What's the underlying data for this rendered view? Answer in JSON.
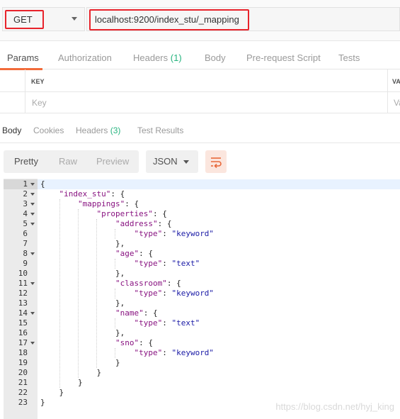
{
  "request": {
    "method": "GET",
    "url": "localhost:9200/index_stu/_mapping"
  },
  "request_tabs": [
    {
      "label": "Params",
      "count": ""
    },
    {
      "label": "Authorization",
      "count": ""
    },
    {
      "label": "Headers",
      "count": "(1)"
    },
    {
      "label": "Body",
      "count": ""
    },
    {
      "label": "Pre-request Script",
      "count": ""
    },
    {
      "label": "Tests",
      "count": ""
    }
  ],
  "params_table": {
    "key_header": "KEY",
    "value_header": "VA",
    "key_placeholder": "Key",
    "value_placeholder": "Va"
  },
  "response_tabs": [
    {
      "label": "Body",
      "count": ""
    },
    {
      "label": "Cookies",
      "count": ""
    },
    {
      "label": "Headers",
      "count": "(3)"
    },
    {
      "label": "Test Results",
      "count": ""
    }
  ],
  "view_modes": [
    "Pretty",
    "Raw",
    "Preview"
  ],
  "format": "JSON",
  "code_lines": [
    {
      "n": "1",
      "fold": true,
      "text": "{"
    },
    {
      "n": "2",
      "fold": true,
      "text": "    \"index_stu\": {"
    },
    {
      "n": "3",
      "fold": true,
      "text": "        \"mappings\": {"
    },
    {
      "n": "4",
      "fold": true,
      "text": "            \"properties\": {"
    },
    {
      "n": "5",
      "fold": true,
      "text": "                \"address\": {"
    },
    {
      "n": "6",
      "fold": false,
      "text": "                    \"type\": \"keyword\""
    },
    {
      "n": "7",
      "fold": false,
      "text": "                },"
    },
    {
      "n": "8",
      "fold": true,
      "text": "                \"age\": {"
    },
    {
      "n": "9",
      "fold": false,
      "text": "                    \"type\": \"text\""
    },
    {
      "n": "10",
      "fold": false,
      "text": "                },"
    },
    {
      "n": "11",
      "fold": true,
      "text": "                \"classroom\": {"
    },
    {
      "n": "12",
      "fold": false,
      "text": "                    \"type\": \"keyword\""
    },
    {
      "n": "13",
      "fold": false,
      "text": "                },"
    },
    {
      "n": "14",
      "fold": true,
      "text": "                \"name\": {"
    },
    {
      "n": "15",
      "fold": false,
      "text": "                    \"type\": \"text\""
    },
    {
      "n": "16",
      "fold": false,
      "text": "                },"
    },
    {
      "n": "17",
      "fold": true,
      "text": "                \"sno\": {"
    },
    {
      "n": "18",
      "fold": false,
      "text": "                    \"type\": \"keyword\""
    },
    {
      "n": "19",
      "fold": false,
      "text": "                }"
    },
    {
      "n": "20",
      "fold": false,
      "text": "            }"
    },
    {
      "n": "21",
      "fold": false,
      "text": "        }"
    },
    {
      "n": "22",
      "fold": false,
      "text": "    }"
    },
    {
      "n": "23",
      "fold": false,
      "text": "}"
    }
  ],
  "watermark": "https://blog.csdn.net/hyj_king",
  "colors": {
    "highlight_border": "#e8232b",
    "accent": "#f26b3a",
    "count": "#26b47f",
    "json_key": "#881280",
    "json_string": "#1a1aa6"
  }
}
